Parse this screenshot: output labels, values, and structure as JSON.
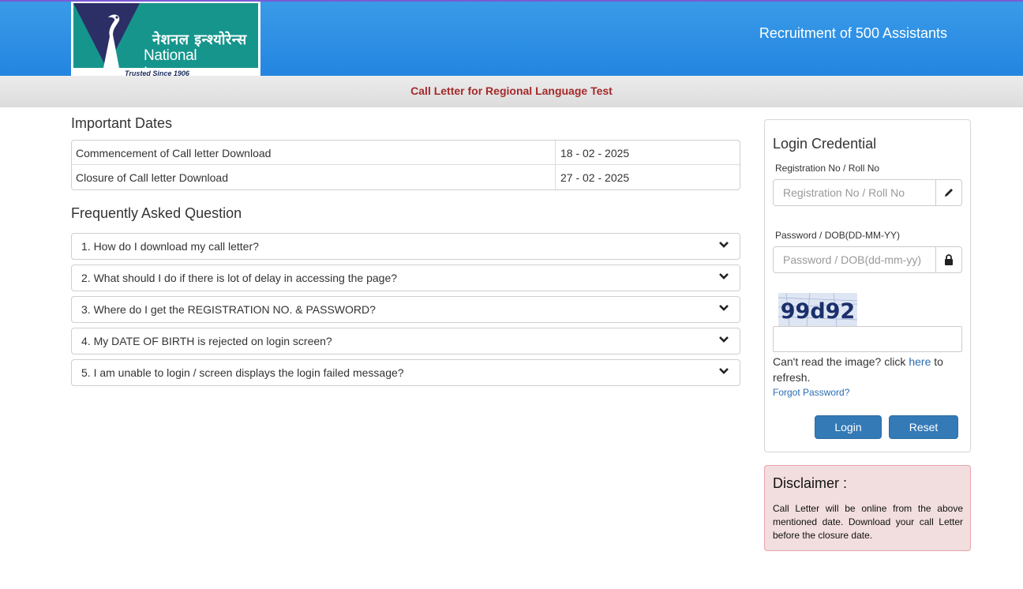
{
  "header": {
    "logo": {
      "hindi": "नेशनल इन्श्योरेन्स",
      "english": "National Insurance",
      "tagline": "Trusted Since 1906"
    },
    "title": "Recruitment of 500 Assistants"
  },
  "subheader": {
    "title": "Call Letter for Regional Language Test"
  },
  "important_dates": {
    "heading": "Important Dates",
    "rows": [
      {
        "label": "Commencement of Call letter Download",
        "date": "18 - 02 - 2025"
      },
      {
        "label": "Closure of Call letter Download",
        "date": "27 - 02 - 2025"
      }
    ]
  },
  "faq": {
    "heading": "Frequently Asked Question",
    "items": [
      "1. How do I download my call letter?",
      "2. What should I do if there is lot of delay in accessing the page?",
      "3. Where do I get the REGISTRATION NO. & PASSWORD?",
      "4. My DATE OF BIRTH is rejected on login screen?",
      "5. I am unable to login / screen displays the login failed message?"
    ],
    "icon": "chevron-down-icon"
  },
  "login": {
    "heading": "Login Credential",
    "registration_label": "Registration No / Roll No",
    "registration_placeholder": "Registration No / Roll No",
    "registration_value": "",
    "registration_icon": "pencil-icon",
    "password_label": "Password / DOB(DD-MM-YY)",
    "password_placeholder": "Password / DOB(dd-mm-yy)",
    "password_value": "",
    "password_icon": "lock-icon",
    "captcha_text": "99d92",
    "captcha_value": "",
    "cant_read_prefix": "Can't read the image? click ",
    "cant_read_link": "here",
    "cant_read_suffix": " to refresh.",
    "forgot": "Forgot Password?",
    "login_button": "Login",
    "reset_button": "Reset"
  },
  "disclaimer": {
    "heading": "Disclaimer :",
    "text": "Call Letter will be online from the above mentioned date. Download your call Letter before the closure date."
  },
  "colors": {
    "header_blue": "#2385e0",
    "logo_teal": "#16958c",
    "subheader_text": "#a52a2a",
    "button_blue": "#337ab7",
    "disclaimer_bg": "#f2dede"
  }
}
